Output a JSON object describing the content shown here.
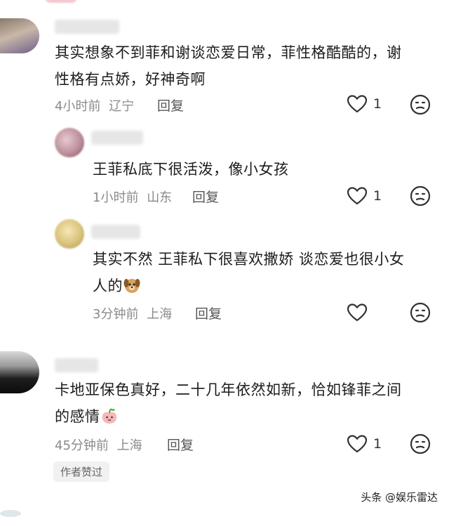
{
  "comments": [
    {
      "level": "top",
      "text_line1": "其实想象不到菲和谢谈恋爱日常，菲性格酷酷的，谢",
      "text_line2": "性格有点娇，好神奇啊",
      "time": "4小时前",
      "location": "辽宁",
      "reply_label": "回复",
      "likes": "1",
      "heart_icon": "heart-outline-icon",
      "dislike_icon": "dislike-face-icon"
    },
    {
      "level": "reply",
      "text_line1": "王菲私底下很活泼，像小女孩",
      "time": "1小时前",
      "location": "山东",
      "reply_label": "回复",
      "likes": "1"
    },
    {
      "level": "reply",
      "text_line1": "其实不然 王菲私下很喜欢撒娇 谈恋爱也很小女",
      "text_line2": "人的",
      "emoji": "dog-emoji",
      "time": "3分钟前",
      "location": "上海",
      "reply_label": "回复",
      "likes": ""
    },
    {
      "level": "top",
      "text_line1": "卡地亚保色真好，二十几年依然如新，恰如锋菲之间",
      "text_line2": "的感情",
      "emoji": "peach-emoji",
      "time": "45分钟前",
      "location": "上海",
      "reply_label": "回复",
      "likes": "1"
    }
  ],
  "author_liked_badge": "作者赞过",
  "watermark": "头条 @娱乐雷达",
  "colors": {
    "text": "#1c1c1c",
    "meta": "#8a8a8a",
    "icon": "#333333",
    "badge_bg": "#f1f1f1"
  }
}
